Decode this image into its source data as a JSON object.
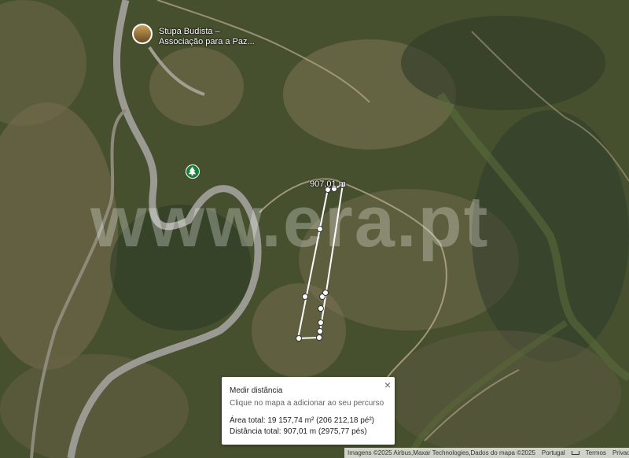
{
  "poi": {
    "name_line1": "Stupa Budista –",
    "name_line2": "Associação para a Paz..."
  },
  "measure": {
    "distance_label": "907,01 m",
    "panel_title": "Medir distância",
    "panel_hint": "Clique no mapa a adicionar ao seu percurso",
    "area_total": "Área total: 19 157,74 m² (206 212,18 pé²)",
    "distance_total": "Distância total: 907,01 m (2975,77 pés)",
    "close_label": "×"
  },
  "watermark": "www.era.pt",
  "footer": {
    "attribution": "Imagens ©2025 Airbus,Maxar Technologies,Dados do mapa ©2025",
    "country": "Portugal",
    "terms": "Termos",
    "privacy": "Privacidade"
  },
  "icons": {
    "poi": "photo-thumbnail-icon",
    "park": "tree-pin-icon",
    "close": "close-icon"
  },
  "colors": {
    "measure_line": "#ffffff",
    "park_pin": "#188038"
  }
}
